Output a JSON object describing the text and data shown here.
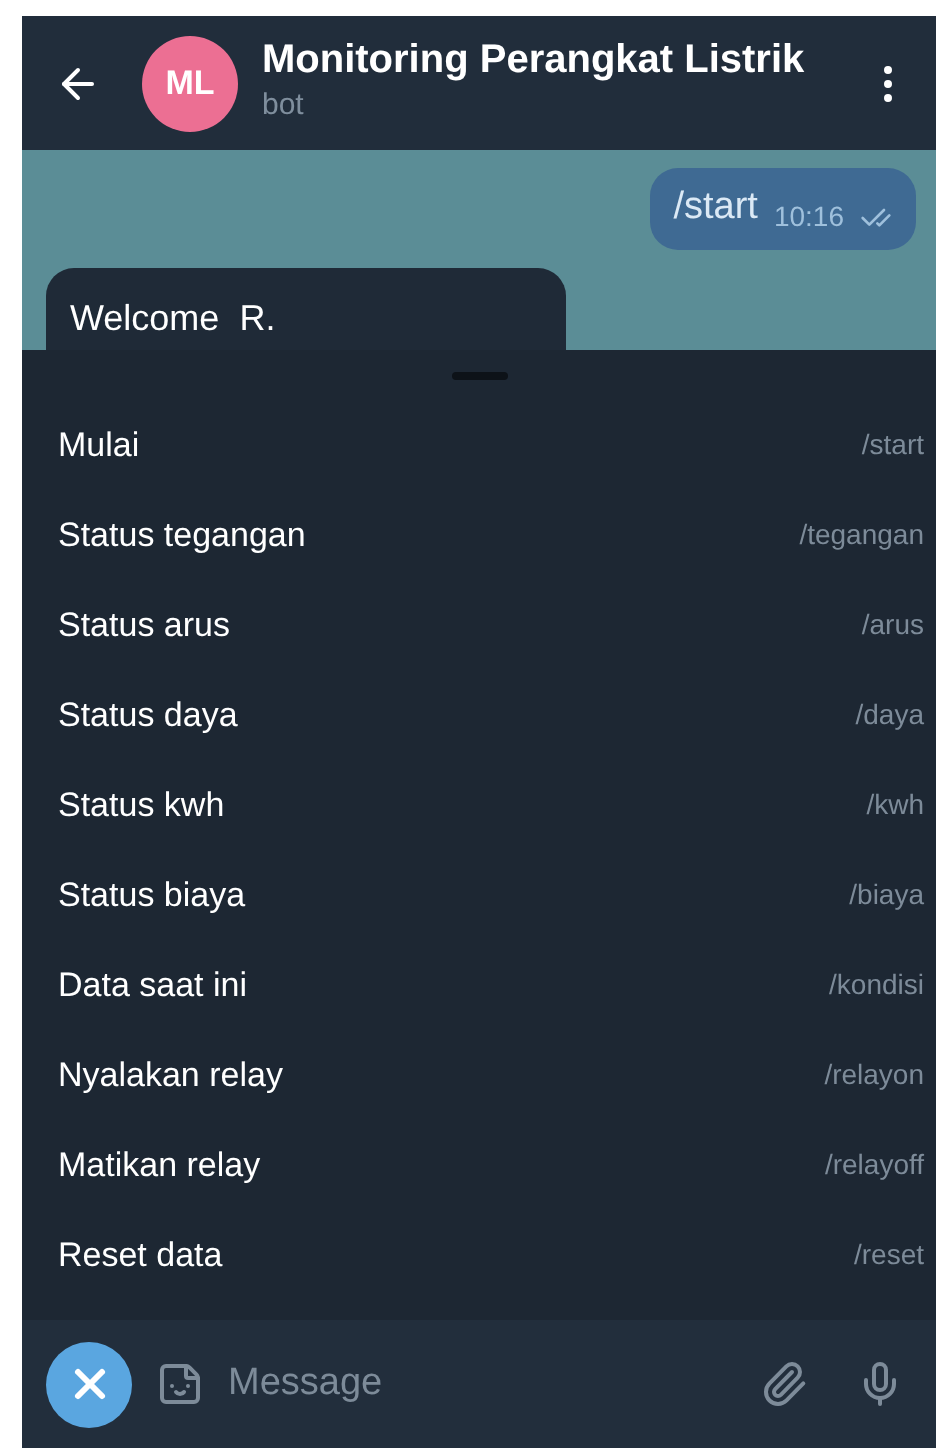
{
  "header": {
    "avatar_initials": "ML",
    "title": "Monitoring Perangkat Listrik",
    "subtitle": "bot"
  },
  "messages": [
    {
      "kind": "outgoing",
      "text": "/start",
      "time": "10:16",
      "read": true
    },
    {
      "kind": "incoming",
      "text": "Welcome  R."
    }
  ],
  "commands": [
    {
      "label": "Mulai",
      "command": "/start"
    },
    {
      "label": "Status tegangan",
      "command": "/tegangan"
    },
    {
      "label": "Status arus",
      "command": "/arus"
    },
    {
      "label": "Status daya",
      "command": "/daya"
    },
    {
      "label": "Status kwh",
      "command": "/kwh"
    },
    {
      "label": "Status biaya",
      "command": "/biaya"
    },
    {
      "label": "Data saat ini",
      "command": "/kondisi"
    },
    {
      "label": "Nyalakan relay",
      "command": "/relayon"
    },
    {
      "label": "Matikan relay",
      "command": "/relayoff"
    },
    {
      "label": "Reset data",
      "command": "/reset"
    }
  ],
  "input": {
    "placeholder": "Message"
  }
}
